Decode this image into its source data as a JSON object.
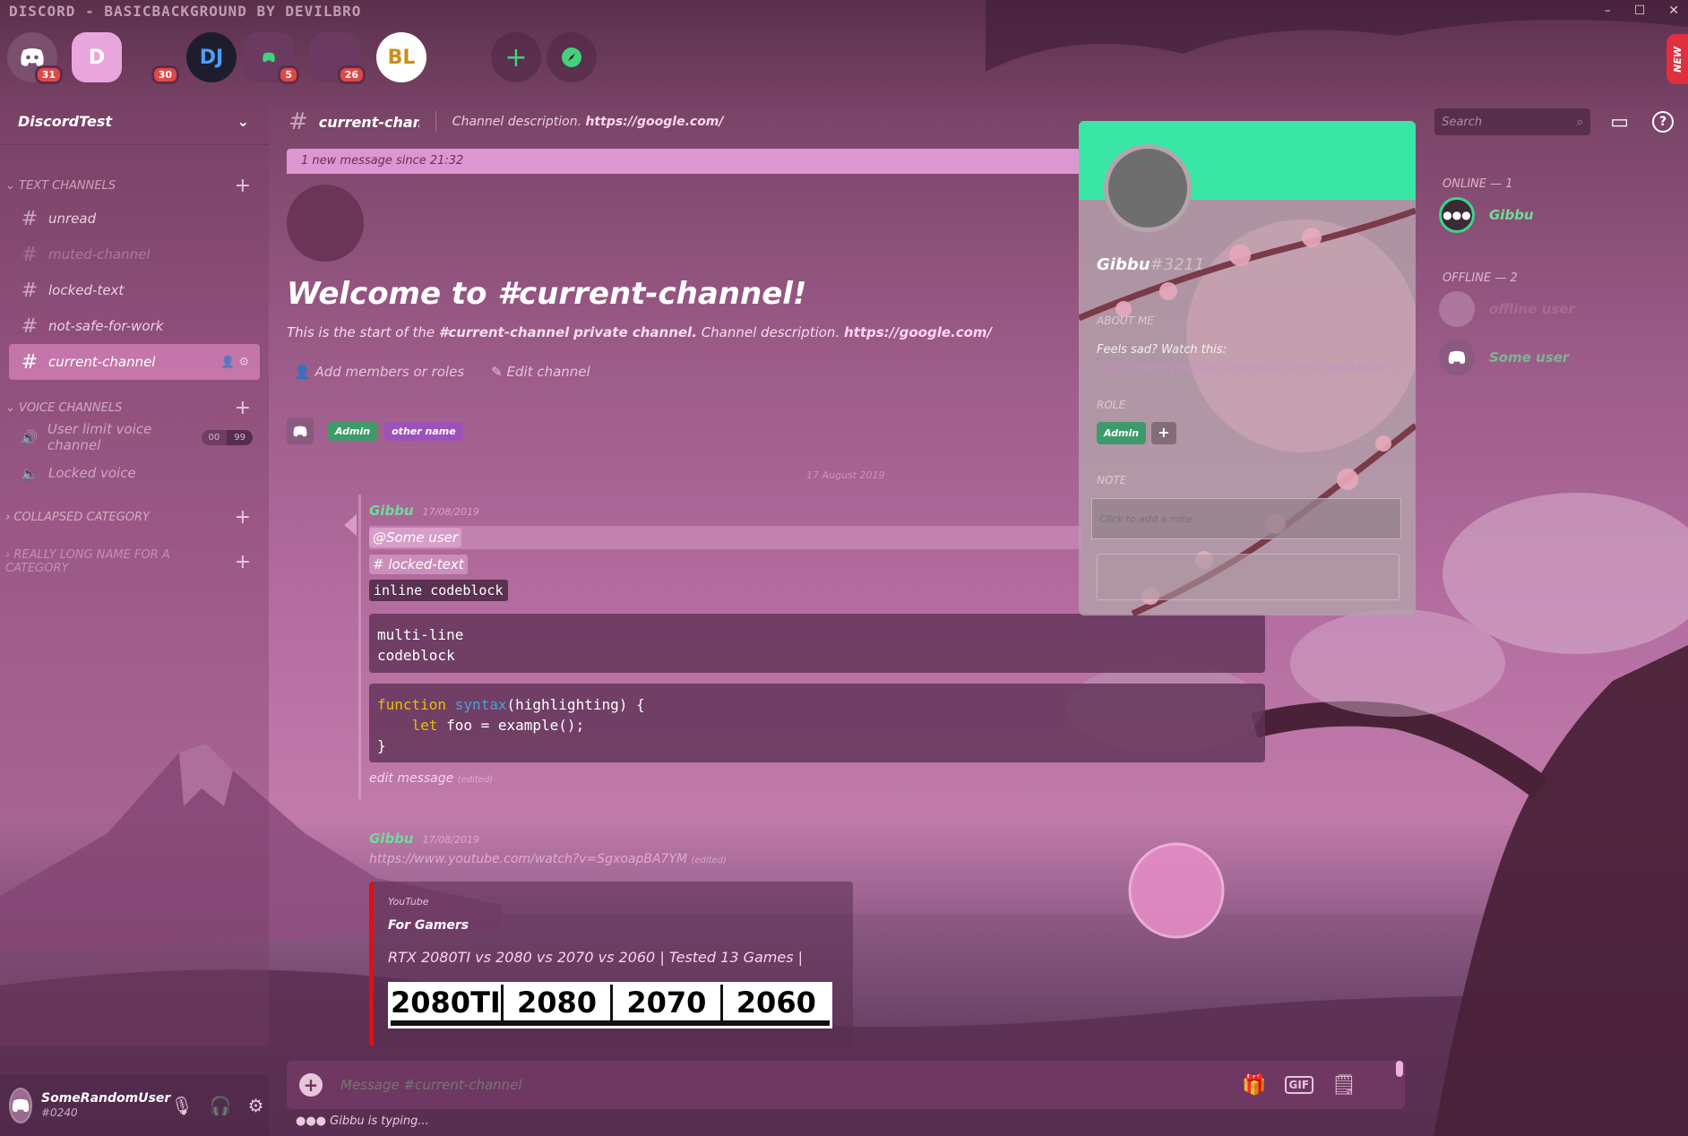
{
  "window": {
    "title": "DISCORD - BASICBACKGROUND BY DEVILBRO",
    "controls": [
      "–",
      "☐",
      "✕"
    ]
  },
  "new_ribbon": "NEW",
  "guilds": [
    {
      "label": "",
      "badge": "31",
      "color": "#7b4f70"
    },
    {
      "label": "D",
      "badge": "",
      "color": "#e8a6dc"
    },
    {
      "label": "",
      "badge": "30",
      "color": "transparent"
    },
    {
      "label": "DJ",
      "badge": "",
      "color": "#1d1d2e"
    },
    {
      "label": "",
      "badge": "5",
      "color": "#6a3a60"
    },
    {
      "label": "",
      "badge": "26",
      "color": "#6a3a60"
    },
    {
      "label": "BL",
      "badge": "",
      "color": "#ffffff"
    }
  ],
  "server": {
    "name": "DiscordTest"
  },
  "categories": {
    "text": "TEXT CHANNELS",
    "voice": "VOICE CHANNELS",
    "collapsed": "COLLAPSED CATEGORY",
    "long": "REALLY LONG NAME FOR A CATEGORY"
  },
  "text_channels": [
    "unread",
    "muted-channel",
    "locked-text",
    "not-safe-for-work",
    "current-channel"
  ],
  "voice_channels": [
    {
      "name": "User limit voice channel",
      "count": "00",
      "limit": "99"
    },
    {
      "name": "Locked voice"
    }
  ],
  "user": {
    "name": "SomeRandomUser",
    "tag": "#0240"
  },
  "header": {
    "channel": "current-channel",
    "desc_prefix": "Channel description.",
    "desc_link": "https://google.com/",
    "search_placeholder": "Search"
  },
  "new_messages": "1 new message since 21:32",
  "welcome": {
    "title": "Welcome to #current-channel!",
    "sub_prefix": "This is the start of the",
    "sub_channel": "#current-channel",
    "sub_private": "private channel.",
    "sub_desc": "Channel description.",
    "sub_link": "https://google.com/",
    "add_members": "Add members or roles",
    "edit_channel": "Edit channel"
  },
  "role_chips": {
    "admin": "Admin",
    "other": "other name"
  },
  "date_divider": "17 August 2019",
  "message1": {
    "author": "Gibbu",
    "timestamp": "17/08/2019",
    "mention_user": "@Some user",
    "mention_channel": "locked-text",
    "inline_code": "inline codeblock",
    "codeblock": "multi-line\ncodeblock",
    "syntax_kw": "function",
    "syntax_fn": "syntax",
    "syntax_rest": "(highlighting) {",
    "syntax_kw2": "let",
    "syntax_line2": " foo = example();",
    "syntax_close": "}",
    "edit_text": "edit message",
    "edited": "(edited)"
  },
  "message2": {
    "author": "Gibbu",
    "timestamp": "17/08/2019",
    "link": "https://www.youtube.com/watch?v=SgxoapBA7YM",
    "edited": "(edited)",
    "embed": {
      "provider": "YouTube",
      "author": "For Gamers",
      "title": "RTX 2080TI vs 2080 vs 2070 vs 2060 | Tested 13 Games |",
      "thumb": [
        "2080TI",
        "2080",
        "2070",
        "2060"
      ]
    }
  },
  "composer": {
    "placeholder": "Message #current-channel",
    "gif": "GIF"
  },
  "typing": {
    "dots": "●●●",
    "text": "Gibbu is typing..."
  },
  "members": {
    "online_header": "ONLINE — 1",
    "offline_header": "OFFLINE — 2",
    "online": [
      "Gibbu"
    ],
    "offline": [
      "offline user",
      "Some user"
    ]
  },
  "popout": {
    "name": "Gibbu",
    "tag": "#3211",
    "about_header": "ABOUT ME",
    "about_text": "Feels sad? Watch this:",
    "about_link": "https://www.youtube.com/watch?v=oYmqJl4MoNI",
    "role_header": "ROLE",
    "role": "Admin",
    "note_header": "NOTE",
    "note_placeholder": "Click to add a note",
    "banner_color": "#39e6a6"
  },
  "accent": {
    "online_green": "#6fdc9c",
    "pink": "#e8a6dc"
  }
}
